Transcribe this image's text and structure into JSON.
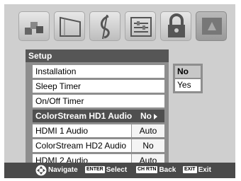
{
  "menu": {
    "title": "Setup",
    "items": [
      {
        "label": "Installation",
        "value": ""
      },
      {
        "label": "Sleep Timer",
        "value": ""
      },
      {
        "label": "On/Off Timer",
        "value": ""
      },
      {
        "label": "ColorStream HD1 Audio",
        "value": "No",
        "selected": true
      },
      {
        "label": "HDMI 1 Audio",
        "value": "Auto"
      },
      {
        "label": "ColorStream HD2 Audio",
        "value": "No"
      },
      {
        "label": "HDMI 2 Audio",
        "value": "Auto"
      }
    ]
  },
  "options": [
    {
      "label": "No",
      "selected": true
    },
    {
      "label": "Yes"
    }
  ],
  "footer": {
    "navigate": "Navigate",
    "enter_key": "ENTER",
    "select": "Select",
    "chrtn_key": "CH RTN",
    "back": "Back",
    "exit_key": "EXIT",
    "exit": "Exit"
  },
  "icons": [
    "picture-icon",
    "screen-icon",
    "audio-icon",
    "preferences-icon",
    "lock-icon",
    "setup-icon"
  ]
}
